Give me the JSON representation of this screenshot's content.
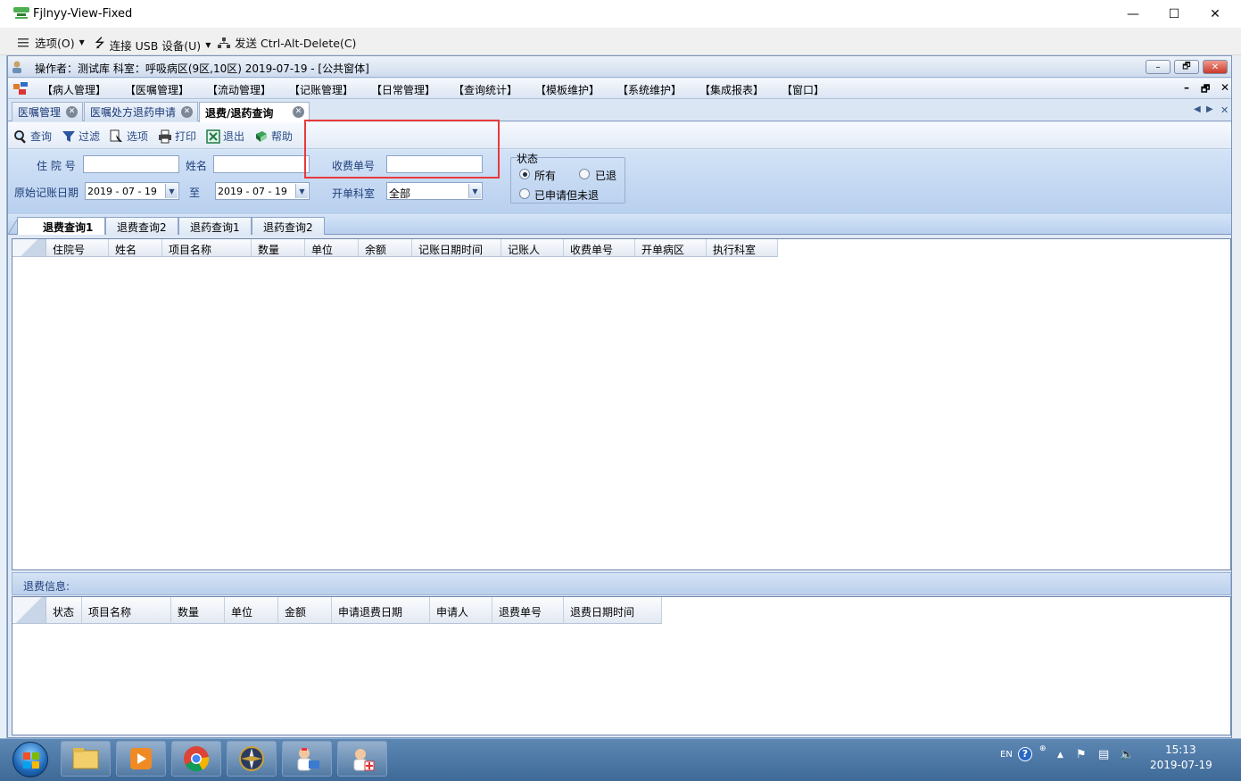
{
  "window": {
    "title": "Fjlnyy-View-Fixed",
    "min": "—",
    "max": "☐",
    "close": "✕"
  },
  "vm_toolbar": {
    "options": "选项(O)",
    "usb": "连接 USB 设备(U)",
    "ctrl_alt_del": "发送 Ctrl-Alt-Delete(C)"
  },
  "app": {
    "operator_line": "操作者：测试库  科室：呼吸病区(9区,10区)  2019-07-19 - [公共窗体]",
    "menu": [
      "【病人管理】",
      "【医嘱管理】",
      "【流动管理】",
      "【记账管理】",
      "【日常管理】",
      "【查询统计】",
      "【模板维护】",
      "【系统维护】",
      "【集成报表】",
      "【窗口】"
    ],
    "mdi_controls": {
      "min": "–",
      "restore": "🗗",
      "close": "✕"
    }
  },
  "tabs": [
    {
      "label": "医嘱管理",
      "active": false
    },
    {
      "label": "医嘱处方退药申请",
      "active": false
    },
    {
      "label": "退费/退药查询",
      "active": true
    }
  ],
  "toolbar": {
    "query": "查询",
    "filter": "过滤",
    "options": "选项",
    "print": "打印",
    "exit": "退出",
    "help": "帮助"
  },
  "filters": {
    "inpatient_no_label": "住 院 号",
    "inpatient_no_value": "",
    "name_label": "姓名",
    "name_value": "",
    "receipt_no_label": "收费单号",
    "receipt_no_value": "",
    "original_date_label": "原始记账日期",
    "date_from": "2019 - 07 - 19",
    "to_label": "至",
    "date_to": "2019 - 07 - 19",
    "dept_label": "开单科室",
    "dept_value": "全部",
    "status": {
      "title": "状态",
      "options": [
        "所有",
        "已退",
        "已申请但未退"
      ],
      "selected": "所有"
    }
  },
  "sub_tabs": [
    "退费查询1",
    "退费查询2",
    "退药查询1",
    "退药查询2"
  ],
  "grid1": {
    "columns": [
      "住院号",
      "姓名",
      "项目名称",
      "数量",
      "单位",
      "余额",
      "记账日期时间",
      "记账人",
      "收费单号",
      "开单病区",
      "执行科室"
    ],
    "rows": []
  },
  "refund_info": {
    "label": "退费信息:",
    "columns": [
      "状态",
      "项目名称",
      "数量",
      "单位",
      "金额",
      "申请退费日期",
      "申请人",
      "退费单号",
      "退费日期时间"
    ],
    "rows": []
  },
  "taskbar": {
    "lang": "EN",
    "time": "15:13",
    "date": "2019-07-19"
  },
  "colors": {
    "highlight": "#e8393b",
    "panel": "#bcd0ec",
    "accent": "#2c4c86"
  }
}
